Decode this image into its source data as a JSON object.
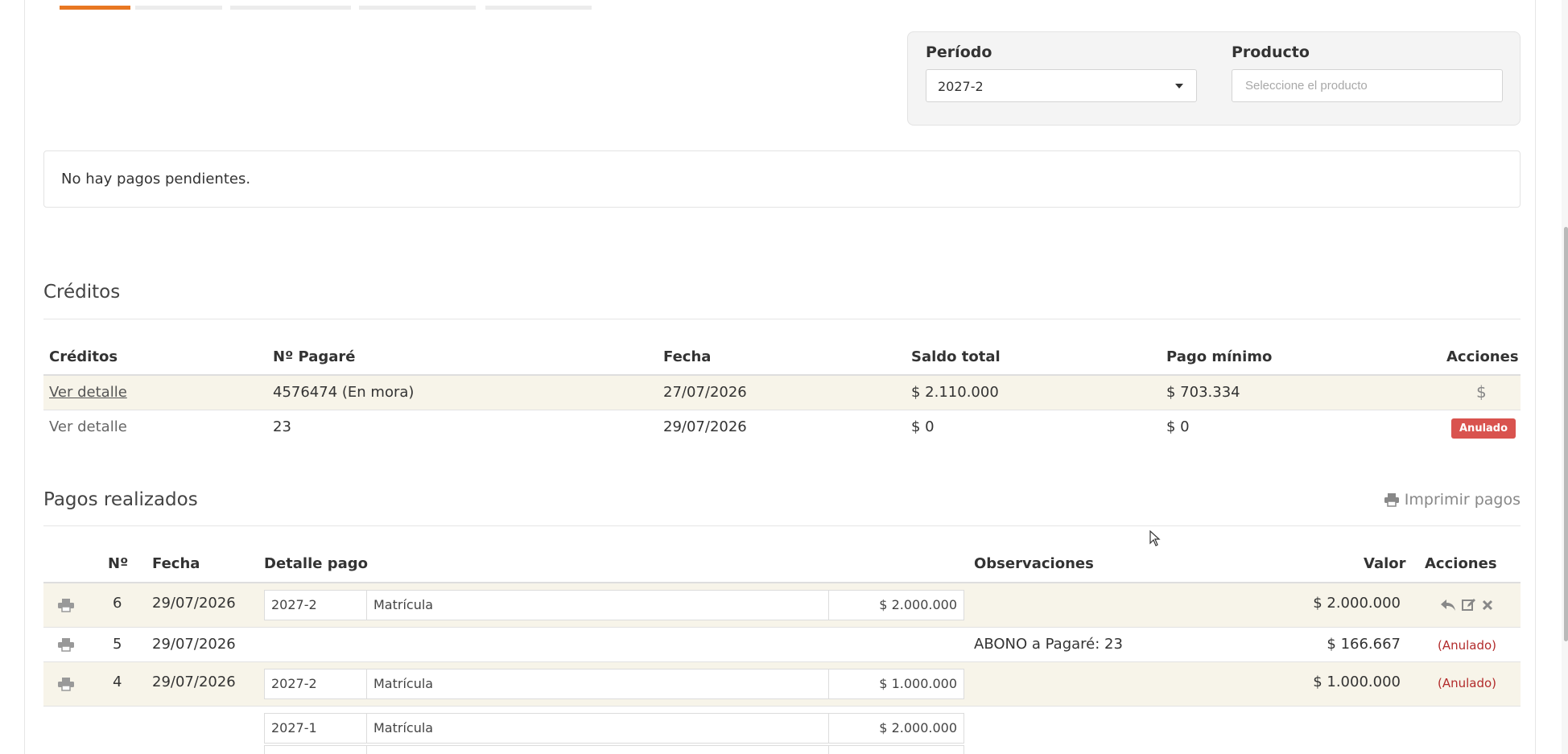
{
  "filters": {
    "period_label": "Período",
    "period_value": "2027-2",
    "product_label": "Producto",
    "product_placeholder": "Seleccione el producto"
  },
  "pending_message": "No hay pagos pendientes.",
  "credits": {
    "title": "Créditos",
    "columns": [
      "Créditos",
      "Nº Pagaré",
      "Fecha",
      "Saldo total",
      "Pago mínimo",
      "Acciones"
    ],
    "rows": [
      {
        "detail": "Ver detalle",
        "pagare": "4576474 (En mora)",
        "fecha": "27/07/2026",
        "saldo": "$ 2.110.000",
        "minimo": "$ 703.334",
        "action": "$"
      },
      {
        "detail": "Ver detalle",
        "pagare": "23",
        "fecha": "29/07/2026",
        "saldo": "$ 0",
        "minimo": "$ 0",
        "action": "Anulado"
      }
    ]
  },
  "payments": {
    "title": "Pagos realizados",
    "print_all_label": "Imprimir pagos",
    "columns": [
      "Nº",
      "Fecha",
      "Detalle pago",
      "Observaciones",
      "Valor",
      "Acciones"
    ],
    "rows": [
      {
        "num": "6",
        "fecha": "29/07/2026",
        "detail": {
          "period": "2027-2",
          "concept": "Matrícula",
          "amount": "$ 2.000.000"
        },
        "obs": "",
        "valor": "$ 2.000.000",
        "status": ""
      },
      {
        "num": "5",
        "fecha": "29/07/2026",
        "detail": null,
        "obs": "ABONO a Pagaré: 23",
        "valor": "$ 166.667",
        "status": "(Anulado)"
      },
      {
        "num": "4",
        "fecha": "29/07/2026",
        "detail": {
          "period": "2027-2",
          "concept": "Matrícula",
          "amount": "$ 1.000.000"
        },
        "obs": "",
        "valor": "$ 1.000.000",
        "status": "(Anulado)"
      },
      {
        "num": "",
        "fecha": "",
        "detail": {
          "period": "2027-1",
          "concept": "Matrícula",
          "amount": "$ 2.000.000"
        },
        "obs": "",
        "valor": "",
        "status": ""
      }
    ]
  },
  "colors": {
    "accent": "#e87722",
    "stripe": "#f7f4e9",
    "danger": "#d9534f",
    "danger_text": "#b22b2b"
  }
}
